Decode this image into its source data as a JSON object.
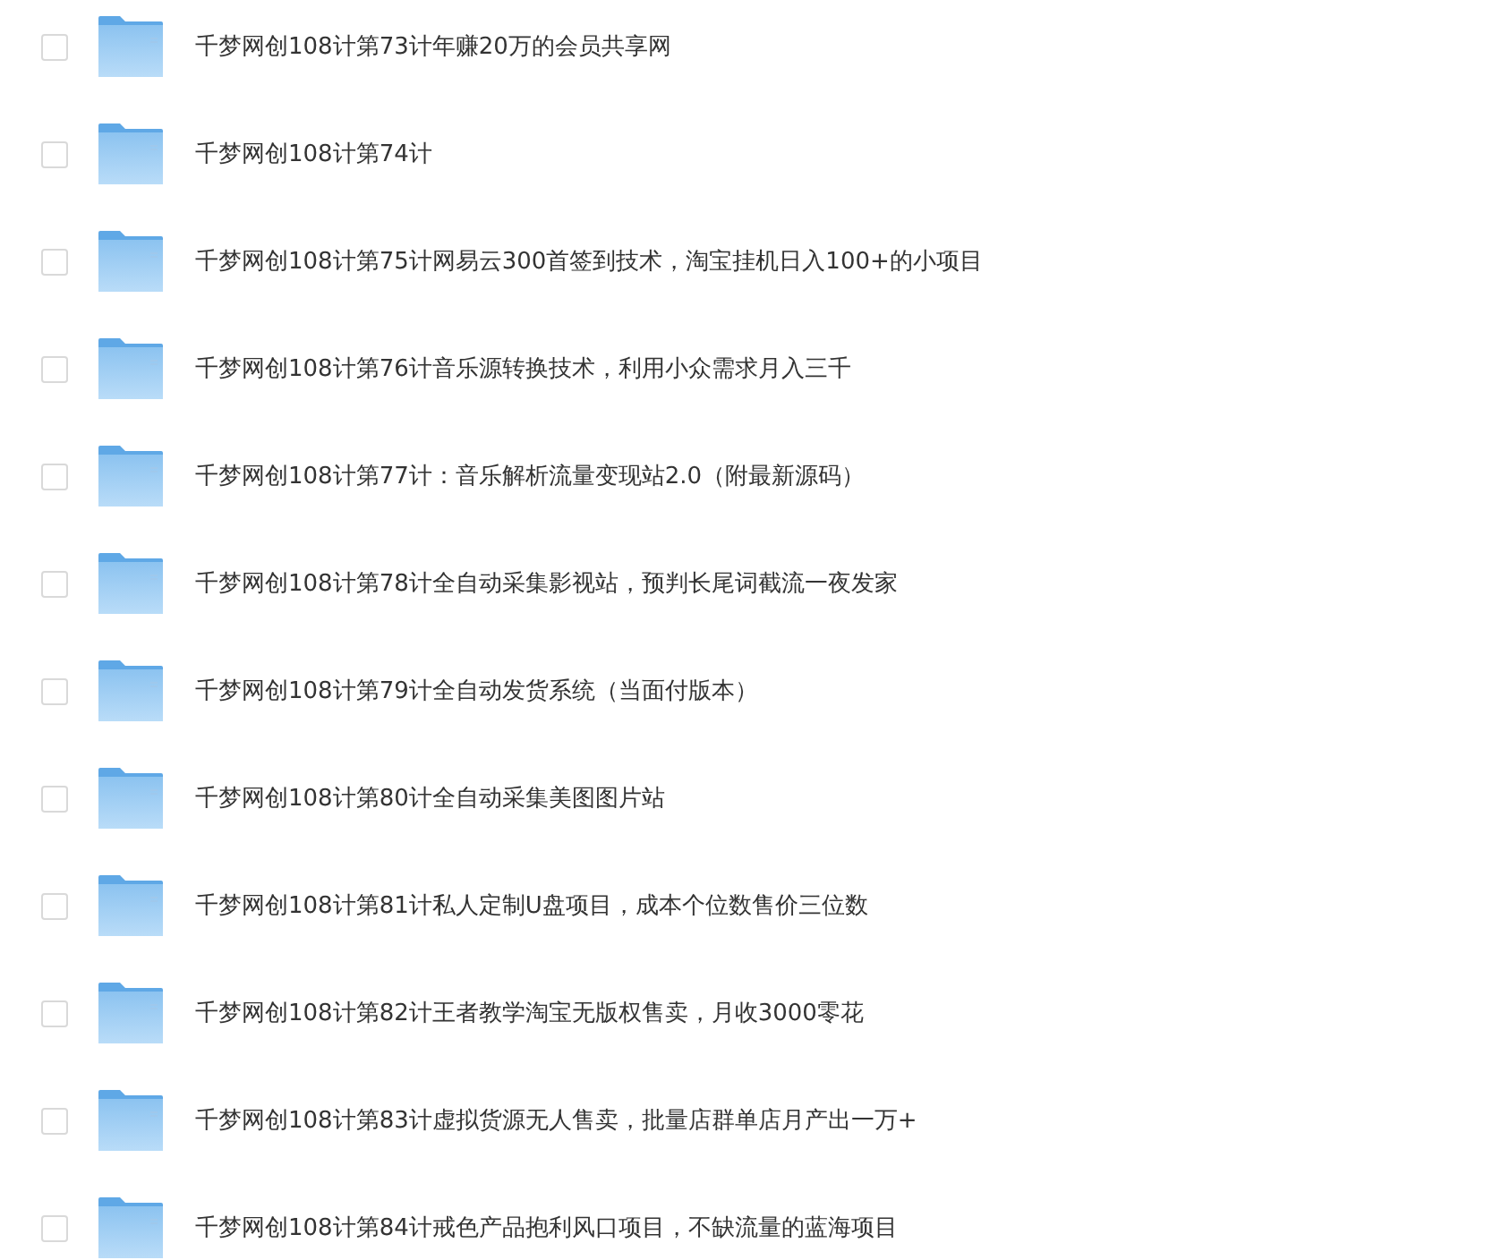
{
  "files": [
    {
      "name": "千梦网创108计第73计年赚20万的会员共享网",
      "checked": false
    },
    {
      "name": "千梦网创108计第74计",
      "checked": false
    },
    {
      "name": "千梦网创108计第75计网易云300首签到技术，淘宝挂机日入100+的小项目",
      "checked": false
    },
    {
      "name": "千梦网创108计第76计音乐源转换技术，利用小众需求月入三千",
      "checked": false
    },
    {
      "name": "千梦网创108计第77计：音乐解析流量变现站2.0（附最新源码）",
      "checked": false
    },
    {
      "name": "千梦网创108计第78计全自动采集影视站，预判长尾词截流一夜发家",
      "checked": false
    },
    {
      "name": "千梦网创108计第79计全自动发货系统（当面付版本）",
      "checked": false
    },
    {
      "name": "千梦网创108计第80计全自动采集美图图片站",
      "checked": false
    },
    {
      "name": "千梦网创108计第81计私人定制U盘项目，成本个位数售价三位数",
      "checked": false
    },
    {
      "name": "千梦网创108计第82计王者教学淘宝无版权售卖，月收3000零花",
      "checked": false
    },
    {
      "name": "千梦网创108计第83计虚拟货源无人售卖，批量店群单店月产出一万+",
      "checked": false
    },
    {
      "name": "千梦网创108计第84计戒色产品抱利风口项目，不缺流量的蓝海项目",
      "checked": false
    }
  ]
}
